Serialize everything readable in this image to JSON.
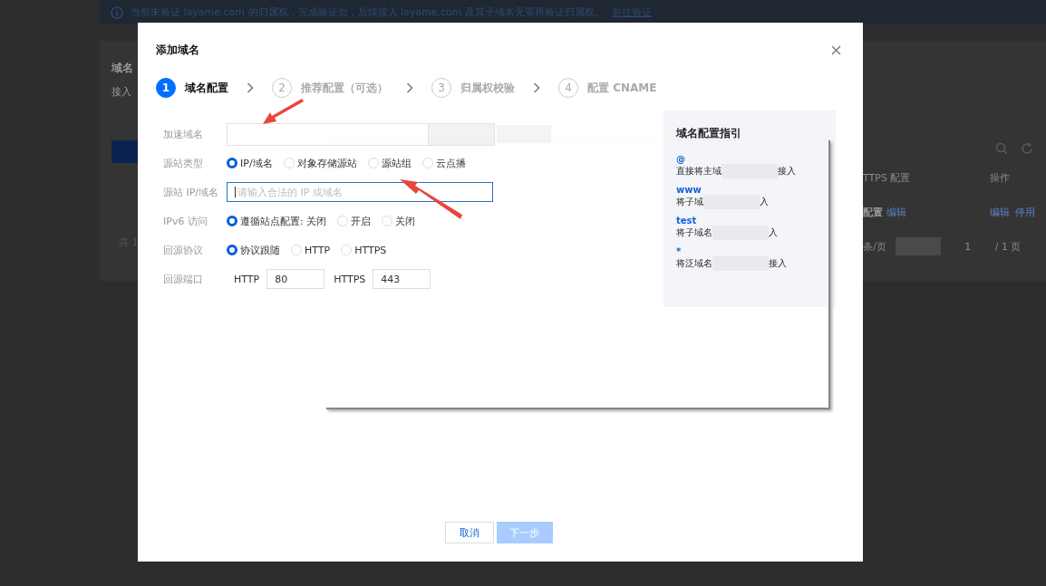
{
  "notice": {
    "text": "当前未验证 layame.com 的归属权，完成验证后，后续接入 layame.com 及其子域名无需再验证归属权。",
    "link": "前往验证"
  },
  "background_page": {
    "heading": "域名",
    "subheading": "接入",
    "count": "共 1",
    "table": {
      "columns": [
        "TTPS 配置",
        "操作"
      ],
      "row": {
        "cell_1": "配置",
        "cell_1_link": "编辑",
        "actions": [
          "编辑",
          "停用"
        ]
      }
    },
    "pager": {
      "per_page": "条/页",
      "page": "1",
      "total_pages": "/ 1 页"
    }
  },
  "dialog": {
    "title": "添加域名",
    "steps": [
      {
        "number": "1",
        "label": "域名配置",
        "selected": true
      },
      {
        "number": "2",
        "label": "推荐配置（可选）",
        "selected": false
      },
      {
        "number": "3",
        "label": "归属权校验",
        "selected": false
      },
      {
        "number": "4",
        "label": "配置 CNAME",
        "selected": false
      }
    ],
    "form": [
      {
        "kind": "domain",
        "label": "加速域名"
      },
      {
        "kind": "radio",
        "label": "源站类型",
        "options": [
          {
            "label": "IP/域名",
            "selected": true
          },
          {
            "label": "对象存储源站",
            "selected": false
          },
          {
            "label": "源站组",
            "selected": false
          },
          {
            "label": "云点播",
            "selected": false
          }
        ]
      },
      {
        "kind": "input",
        "label": "源站 IP/域名",
        "placeholder": "请输入合法的 IP 或域名"
      },
      {
        "kind": "radio",
        "label": "IPv6 访问",
        "options": [
          {
            "label": "遵循站点配置: 关闭",
            "selected": true
          },
          {
            "label": "开启",
            "selected": false
          },
          {
            "label": "关闭",
            "selected": false
          }
        ]
      },
      {
        "kind": "radio",
        "label": "回源协议",
        "options": [
          {
            "label": "协议跟随",
            "selected": true
          },
          {
            "label": "HTTP",
            "selected": false
          },
          {
            "label": "HTTPS",
            "selected": false
          }
        ]
      },
      {
        "kind": "ports",
        "label": "回源端口",
        "ports": [
          {
            "label": "HTTP",
            "value": "80"
          },
          {
            "label": "HTTPS",
            "value": "443"
          }
        ]
      }
    ],
    "guide": {
      "title": "域名配置指引",
      "items": [
        {
          "key": "@",
          "before": "直接将主域",
          "after": "接入"
        },
        {
          "key": "www",
          "before": "将子域",
          "after": "入"
        },
        {
          "key": "test",
          "before": "将子域名",
          "after": "入"
        },
        {
          "key": "*",
          "before": "将泛域名",
          "after": "接入"
        }
      ]
    },
    "buttons": [
      {
        "label": "取消",
        "kind": "secondary",
        "disabled": false
      },
      {
        "label": "下一步",
        "kind": "primary",
        "disabled": true
      }
    ]
  }
}
